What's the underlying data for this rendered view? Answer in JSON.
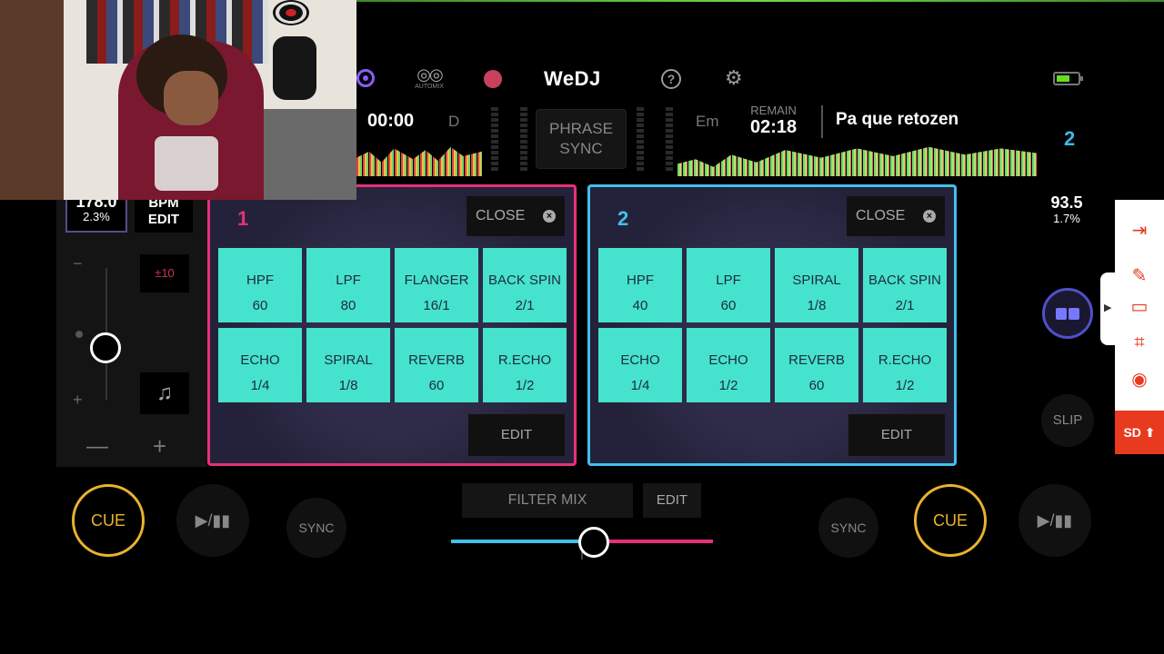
{
  "app": {
    "logo": "WeDJ",
    "automix_label": "AUTOMIX",
    "help_icon": "?"
  },
  "deck1": {
    "time": "00:00",
    "key": "D",
    "bpm": "178.0",
    "pitch": "2.3%",
    "bpm_edit": "BPM\nEDIT",
    "pitch_range": "±10",
    "number": "1",
    "fx_close": "CLOSE",
    "fx_edit": "EDIT",
    "pads": [
      {
        "name": "HPF",
        "value": "60"
      },
      {
        "name": "LPF",
        "value": "80"
      },
      {
        "name": "FLANGER",
        "value": "16/1"
      },
      {
        "name": "BACK SPIN",
        "value": "2/1"
      },
      {
        "name": "ECHO",
        "value": "1/4"
      },
      {
        "name": "SPIRAL",
        "value": "1/8"
      },
      {
        "name": "REVERB",
        "value": "60"
      },
      {
        "name": "R.ECHO",
        "value": "1/2"
      }
    ],
    "cue": "CUE",
    "play": "▶/▮▮",
    "sync": "SYNC"
  },
  "center": {
    "phrase_sync": "PHRASE\nSYNC",
    "filter_mix": "FILTER MIX",
    "filter_edit": "EDIT",
    "crossfader_position": 0.55
  },
  "deck2": {
    "key": "Em",
    "remain_label": "REMAIN",
    "remain": "02:18",
    "track": "Pa que retozen",
    "number": "2",
    "bpm": "93.5",
    "pitch": "1.7%",
    "fx_close": "CLOSE",
    "fx_edit": "EDIT",
    "pads": [
      {
        "name": "HPF",
        "value": "40"
      },
      {
        "name": "LPF",
        "value": "60"
      },
      {
        "name": "SPIRAL",
        "value": "1/8"
      },
      {
        "name": "BACK SPIN",
        "value": "2/1"
      },
      {
        "name": "ECHO",
        "value": "1/4"
      },
      {
        "name": "ECHO",
        "value": "1/2"
      },
      {
        "name": "REVERB",
        "value": "60"
      },
      {
        "name": "R.ECHO",
        "value": "1/2"
      }
    ],
    "cue": "CUE",
    "play": "▶/▮▮",
    "sync": "SYNC",
    "slip": "SLIP"
  },
  "recorder": {
    "sd_label": "SD"
  },
  "colors": {
    "deck1": "#e8307a",
    "deck2": "#42c0ec",
    "pad": "#45e3cd",
    "cue": "#e8b32e"
  }
}
